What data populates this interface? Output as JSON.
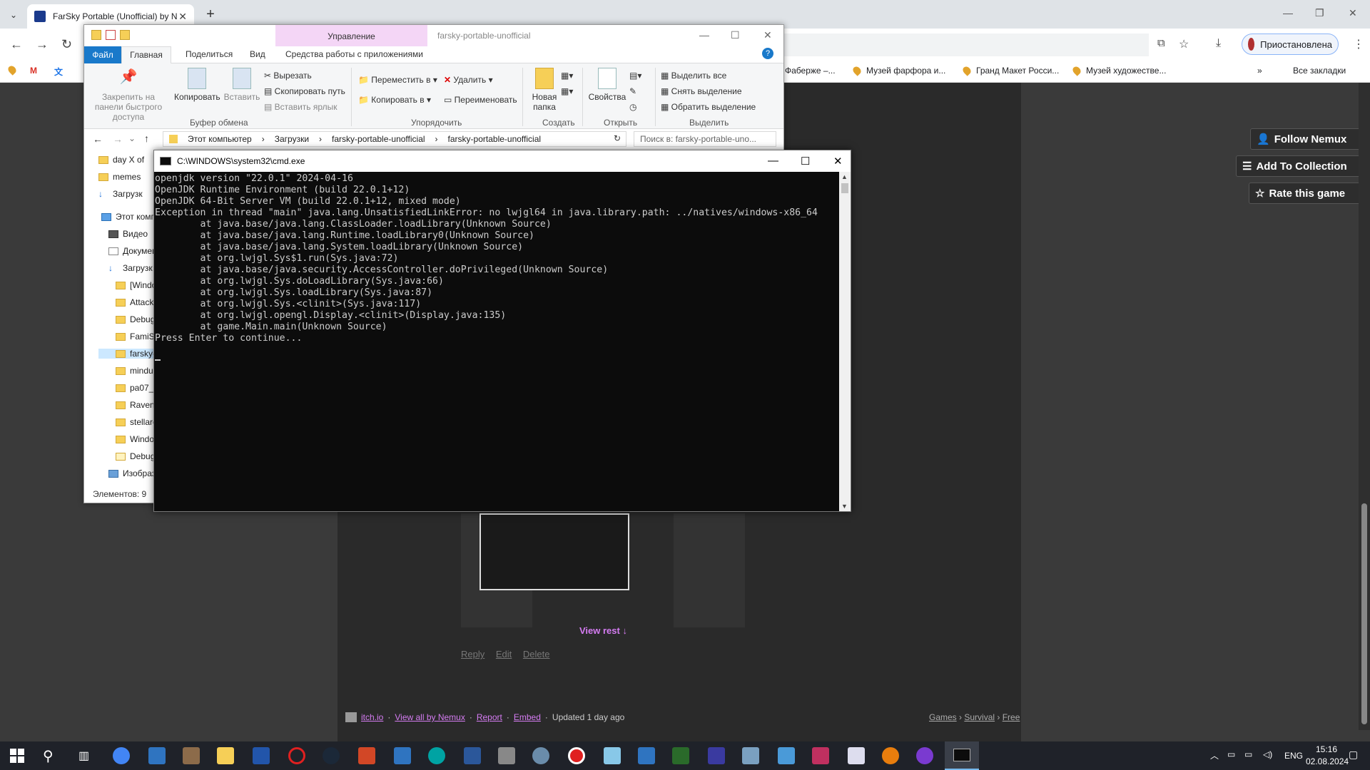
{
  "browser": {
    "tab_title": "FarSky Portable (Unofficial) by N",
    "paused_label": "Приостановлена",
    "bookmarks": [
      "Фаберже –...",
      "Музей фарфора и...",
      "Гранд Макет Росси...",
      "Музей художестве..."
    ],
    "all_bookmarks": "Все закладки"
  },
  "itch": {
    "follow": "Follow Nemux",
    "add_collection": "Add To Collection",
    "rate": "Rate this game",
    "view_rest": "View rest ↓",
    "comment_actions": [
      "Reply",
      "Edit",
      "Delete"
    ],
    "footer": {
      "site": "itch.io",
      "view_all": "View all by Nemux",
      "report": "Report",
      "embed": "Embed",
      "updated": "Updated 1 day ago",
      "crumbs": [
        "Games",
        "Survival",
        "Free"
      ]
    }
  },
  "explorer": {
    "manage_tab": "Управление",
    "window_title": "farsky-portable-unofficial",
    "tabs": {
      "file": "Файл",
      "home": "Главная",
      "share": "Поделиться",
      "view": "Вид",
      "app_tools": "Средства работы с приложениями"
    },
    "ribbon": {
      "pin": "Закрепить на панели быстрого доступа",
      "copy": "Копировать",
      "paste": "Вставить",
      "cut": "Вырезать",
      "copy_path": "Скопировать путь",
      "paste_shortcut": "Вставить ярлык",
      "clipboard": "Буфер обмена",
      "move_to": "Переместить в",
      "copy_to": "Копировать в",
      "delete": "Удалить",
      "rename": "Переименовать",
      "organize": "Упорядочить",
      "new_folder": "Новая папка",
      "create": "Создать",
      "properties": "Свойства",
      "open": "Открыть",
      "select_all": "Выделить все",
      "select_none": "Снять выделение",
      "invert": "Обратить выделение",
      "select": "Выделить"
    },
    "address": [
      "Этот компьютер",
      "Загрузки",
      "farsky-portable-unofficial",
      "farsky-portable-unofficial"
    ],
    "search_placeholder": "Поиск в: farsky-portable-uno...",
    "tree": [
      "day X of",
      "memes",
      "Загрузк",
      "Этот комп",
      "Видео",
      "Докумен",
      "Загрузк",
      "[Windo",
      "Attack",
      "Debug",
      "FamiSt",
      "farsky-",
      "mindu",
      "pa07_0",
      "Ravenf",
      "stellarc",
      "Windo",
      "Debug",
      "Изобраз"
    ],
    "status": "Элементов: 9"
  },
  "cmd": {
    "title": "C:\\WINDOWS\\system32\\cmd.exe",
    "lines": [
      "openjdk version \"22.0.1\" 2024-04-16",
      "OpenJDK Runtime Environment (build 22.0.1+12)",
      "OpenJDK 64-Bit Server VM (build 22.0.1+12, mixed mode)",
      "Exception in thread \"main\" java.lang.UnsatisfiedLinkError: no lwjgl64 in java.library.path: ../natives/windows-x86_64",
      "        at java.base/java.lang.ClassLoader.loadLibrary(Unknown Source)",
      "        at java.base/java.lang.Runtime.loadLibrary0(Unknown Source)",
      "        at java.base/java.lang.System.loadLibrary(Unknown Source)",
      "        at org.lwjgl.Sys$1.run(Sys.java:72)",
      "        at java.base/java.security.AccessController.doPrivileged(Unknown Source)",
      "        at org.lwjgl.Sys.doLoadLibrary(Sys.java:66)",
      "        at org.lwjgl.Sys.loadLibrary(Sys.java:87)",
      "        at org.lwjgl.Sys.<clinit>(Sys.java:117)",
      "        at org.lwjgl.opengl.Display.<clinit>(Display.java:135)",
      "        at game.Main.main(Unknown Source)",
      "Press Enter to continue..."
    ]
  },
  "taskbar": {
    "lang": "ENG",
    "time": "15:16",
    "date": "02.08.2024"
  }
}
